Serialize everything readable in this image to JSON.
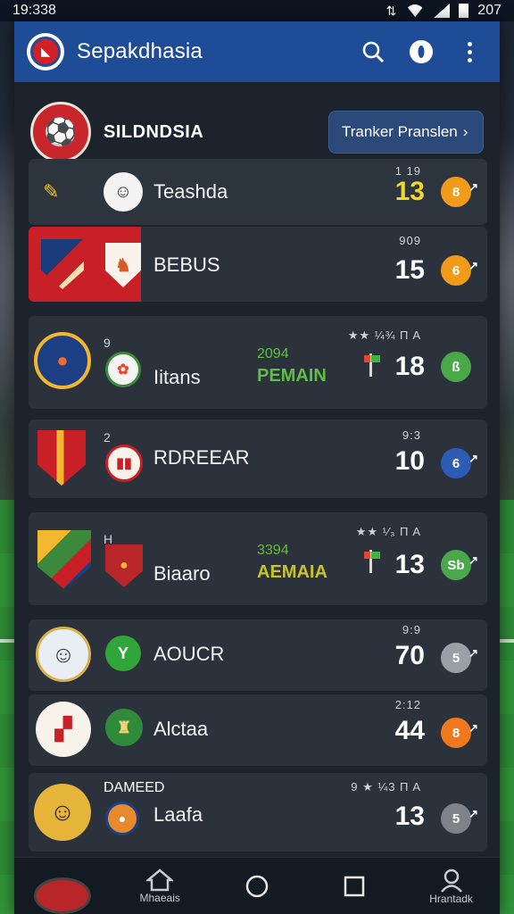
{
  "status_bar": {
    "time": "19:338",
    "battery_text": "207"
  },
  "app_bar": {
    "title": "Sepakdhasia",
    "icons": [
      "search-icon",
      "info-icon",
      "more-vert-icon"
    ]
  },
  "club_header": {
    "name": "SILDNDSIA",
    "transfer_button": "Tranker Pranslen",
    "transfer_arrow": "›"
  },
  "rows": [
    {
      "name": "Teashda",
      "small": "1 19",
      "score": "13",
      "score_color": "#f1d531",
      "badge": "8",
      "badge_color": "#f29a1a"
    },
    {
      "name": "BEBUS",
      "small": "909",
      "score": "15",
      "score_color": "#ffffff",
      "badge": "6",
      "badge_color": "#f29a1a"
    },
    {
      "name": "Iitans",
      "sub": "9",
      "mid_sub": "2094",
      "mid": "PEMAIN",
      "small": "★★ ¼¾ Π Α",
      "score": "18",
      "badge": "ß",
      "badge_color": "#4aa84a"
    },
    {
      "name": "RDREEAR",
      "sub": "2",
      "small": "9:3",
      "score": "10",
      "badge": "6",
      "badge_color": "#2d5cb5"
    },
    {
      "name": "Biaaro",
      "sub": "H",
      "mid_sub": "3394",
      "mid": "AEMAIA",
      "small": "★★ ¹⁄₃ Π Α",
      "score": "13",
      "badge": "Sb",
      "badge_color": "#4aa84a"
    },
    {
      "name": "AOUCR",
      "small": "9:9",
      "score": "70",
      "badge": "5",
      "badge_color": "#9aa0a6"
    },
    {
      "name": "Alctaa",
      "small": "2:12",
      "score": "44",
      "badge": "8",
      "badge_color": "#f0781e"
    },
    {
      "name": "Laafa",
      "sub": "DAMEED",
      "small": "9 ★ ¼3 Π Α",
      "score": "13",
      "badge": "5",
      "badge_color": "#7f8389"
    }
  ],
  "bottom_nav": [
    {
      "label": "",
      "icon": "club-crest-icon"
    },
    {
      "label": "Mhaeais",
      "icon": "home-icon"
    },
    {
      "label": "",
      "icon": "circle-icon"
    },
    {
      "label": "",
      "icon": "square-icon"
    },
    {
      "label": "Hrantadk",
      "icon": "profile-icon"
    }
  ]
}
